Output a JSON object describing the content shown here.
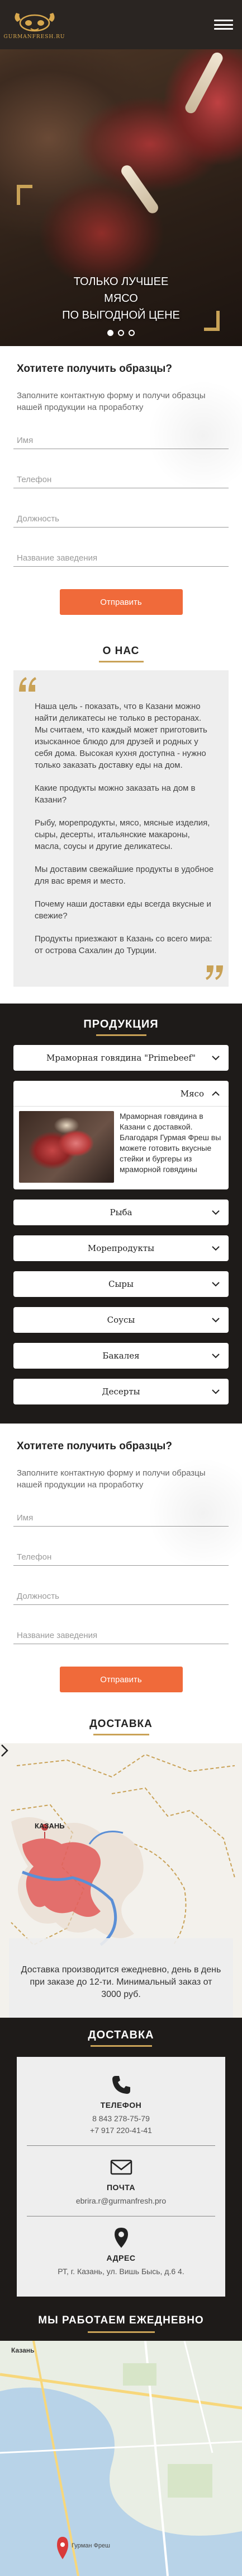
{
  "header": {
    "logo_text": "GURMANFRESH.RU",
    "menu_icon": "hamburger-icon"
  },
  "hero": {
    "line1": "ТОЛЬКО ЛУЧШЕЕ",
    "line2": "МЯСО",
    "line3": "ПО ВЫГОДНОЙ ЦЕНЕ",
    "slides": 3,
    "active_slide": 1
  },
  "form1": {
    "title": "Хотитете получить образцы?",
    "description": "Заполните контактную форму и получи образцы нашей продукции на проработку",
    "fields": {
      "name_placeholder": "Имя",
      "phone_placeholder": "Телефон",
      "position_placeholder": "Должность",
      "venue_placeholder": "Название заведения"
    },
    "submit_label": "Отправить"
  },
  "about": {
    "title": "О НАС",
    "paragraphs": [
      "Наша цель - показать, что в Казани можно найти деликатесы не только в ресторанах. Мы считаем, что каждый может приготовить изысканное блюдо для друзей и родных у себя дома. Высокая кухня доступна - нужно только заказать доставку еды на дом.",
      "Какие продукты можно заказать на дом в Казани?",
      "Рыбу, морепродукты, мясо, мясные изделия, сыры, десерты, итальянские макароны, масла, соусы и другие деликатесы.",
      "Мы доставим свежайшие продукты в удобное для вас время и место.",
      "Почему наши доставки еды всегда вкусные и свежие?",
      "Продукты приезжают в Казань со всего мира: от острова Сахалин до Турции."
    ]
  },
  "products": {
    "title": "ПРОДУКЦИЯ",
    "top_item": "Мраморная говядина \"Primebeef\"",
    "featured": {
      "label": "Мясо",
      "text": "Мраморная говядина в Казани с доставкой. Благодаря Гурмая Фреш вы можете готовить вкусные стейки и бургеры из мраморной говядины"
    },
    "items": [
      "Рыба",
      "Морепродукты",
      "Сыры",
      "Соусы",
      "Бакалея",
      "Десерты"
    ]
  },
  "form2": {
    "title": "Хотитете получить образцы?",
    "description": "Заполните контактную форму и получи образцы нашей продукции на проработку",
    "fields": {
      "name_placeholder": "Имя",
      "phone_placeholder": "Телефон",
      "position_placeholder": "Должность",
      "venue_placeholder": "Название заведения"
    },
    "submit_label": "Отправить"
  },
  "delivery": {
    "title": "ДОСТАВКА",
    "city_label": "КАЗАНЬ",
    "text": "Доставка производится ежедневно, день в день при заказе до 12-ти. Минимальный заказ от 3000 руб."
  },
  "contacts": {
    "title": "ДОСТАВКА",
    "phone_label": "ТЕЛЕФОН",
    "phone_1": "8 843 278-75-79",
    "phone_2": "+7 917 220-41-41",
    "mail_label": "ПОЧТА",
    "mail": "ebrira.r@gurmanfresh.pro",
    "address_label": "АДРЕС",
    "address": "РТ, г. Казань, ул. Вишь Бысь, д.6 4."
  },
  "schedule": {
    "title": "МЫ РАБОТАЕМ ЕЖЕДНЕВНО",
    "map_city": "Казань",
    "map_place": "Гурман Фреш"
  },
  "colors": {
    "accent": "#f06a3a",
    "gold": "#c9a257",
    "dark": "#1e1b19"
  }
}
